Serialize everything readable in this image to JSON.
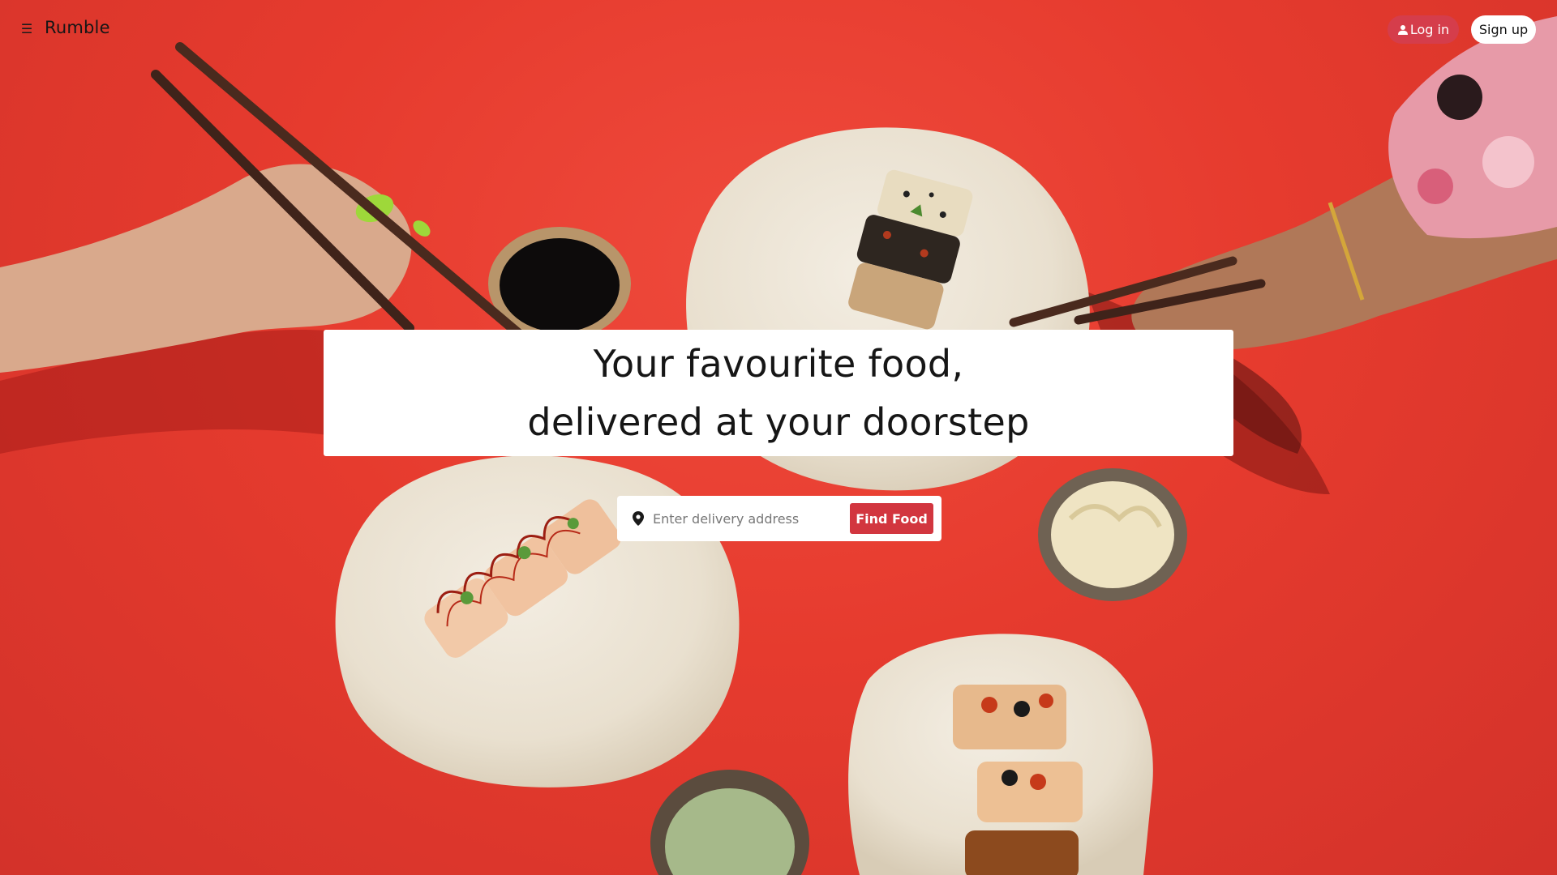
{
  "header": {
    "brand": "Rumble",
    "menu_icon": "hamburger-menu-icon",
    "login_label": "Log in",
    "login_icon": "user-icon",
    "signup_label": "Sign up"
  },
  "hero": {
    "headline_line1": "Your favourite food,",
    "headline_line2": "delivered at your doorstep"
  },
  "search": {
    "placeholder": "Enter delivery address",
    "location_icon": "map-pin-icon",
    "button_label": "Find Food"
  },
  "colors": {
    "background": "#e63b2e",
    "accent": "#d2363f",
    "login_button": "#d53d4b"
  }
}
